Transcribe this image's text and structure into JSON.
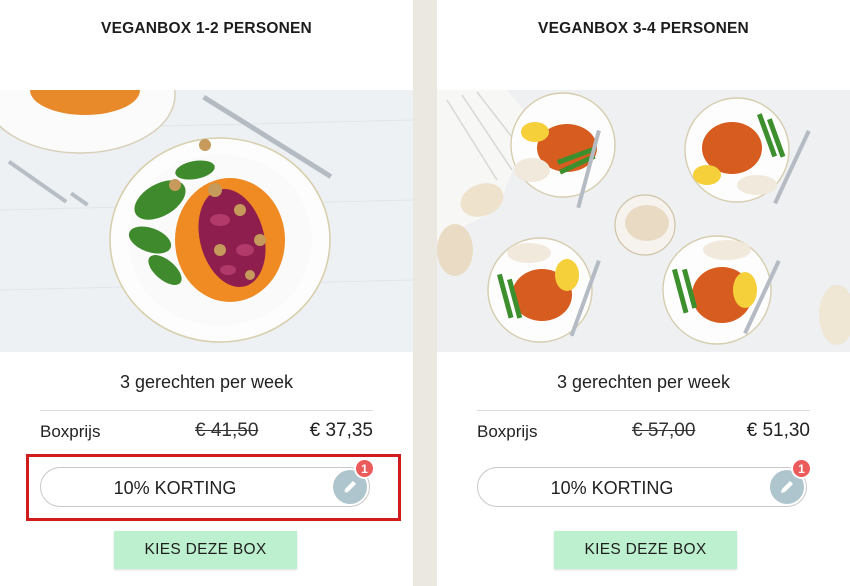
{
  "boxes": [
    {
      "title": "VEGANBOX 1-2 PERSONEN",
      "meals_per_week": "3 gerechten per week",
      "price_label": "Boxprijs",
      "old_price": "€ 41,50",
      "new_price": "€ 37,35",
      "discount_label": "10% KORTING",
      "badge_count": "1",
      "cta_label": "KIES DEZE BOX"
    },
    {
      "title": "VEGANBOX 3-4 PERSONEN",
      "meals_per_week": "3 gerechten per week",
      "price_label": "Boxprijs",
      "old_price": "€ 57,00",
      "new_price": "€ 51,30",
      "discount_label": "10% KORTING",
      "badge_count": "1",
      "cta_label": "KIES DEZE BOX"
    }
  ],
  "icons": {
    "edit": "pencil-icon"
  },
  "colors": {
    "page_background": "#ebe8e1",
    "cta_background": "#bdf0cf",
    "badge": "#ec5b5b",
    "highlight_border": "#d01c1c",
    "edit_circle": "#aec5cd"
  }
}
